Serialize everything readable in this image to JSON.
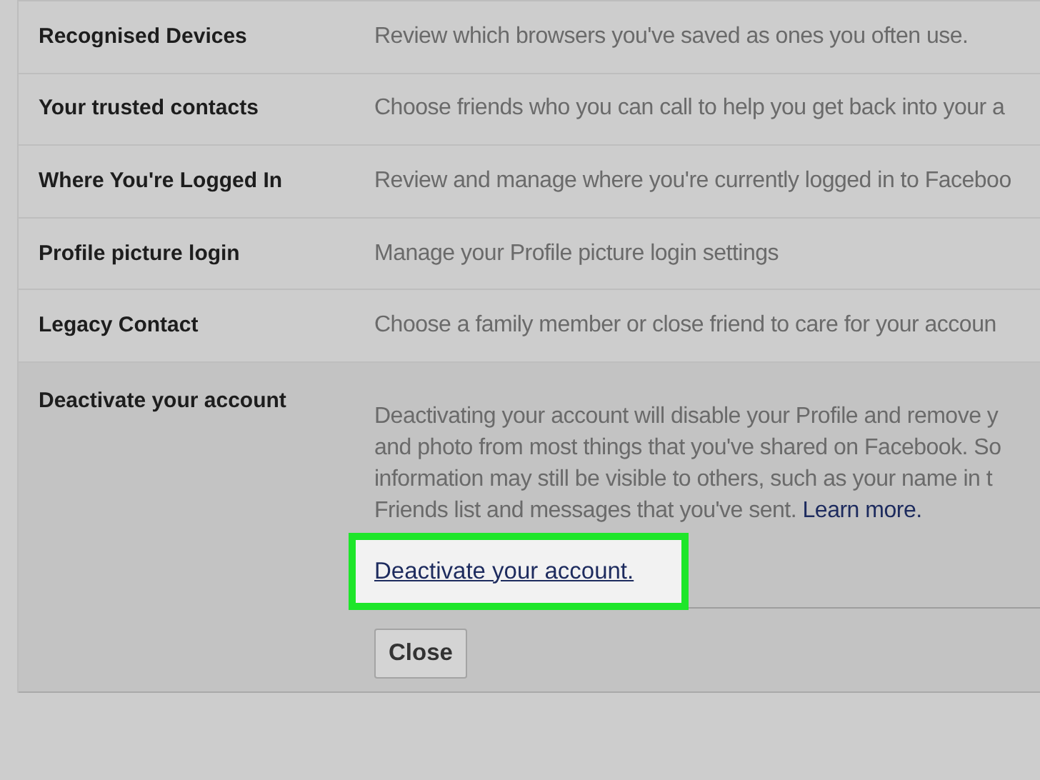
{
  "settings_rows": [
    {
      "label": "Recognised Devices",
      "description": "Review which browsers you've saved as ones you often use."
    },
    {
      "label": "Your trusted contacts",
      "description": "Choose friends who you can call to help you get back into your a"
    },
    {
      "label": "Where You're Logged In",
      "description": "Review and manage where you're currently logged in to Faceboo"
    },
    {
      "label": "Profile picture login",
      "description": "Manage your Profile picture login settings"
    },
    {
      "label": "Legacy Contact",
      "description": "Choose a family member or close friend to care for your accoun"
    }
  ],
  "expanded_section": {
    "label": "Deactivate your account",
    "paragraph_lines": [
      "Deactivating your account will disable your Profile and remove y",
      "and photo from most things that you've shared on Facebook. So",
      "information may still be visible to others, such as your name in t",
      "Friends list and messages that you've sent."
    ],
    "learn_more_link": "Learn more.",
    "deactivate_link": "Deactivate your account.",
    "close_button": "Close"
  }
}
